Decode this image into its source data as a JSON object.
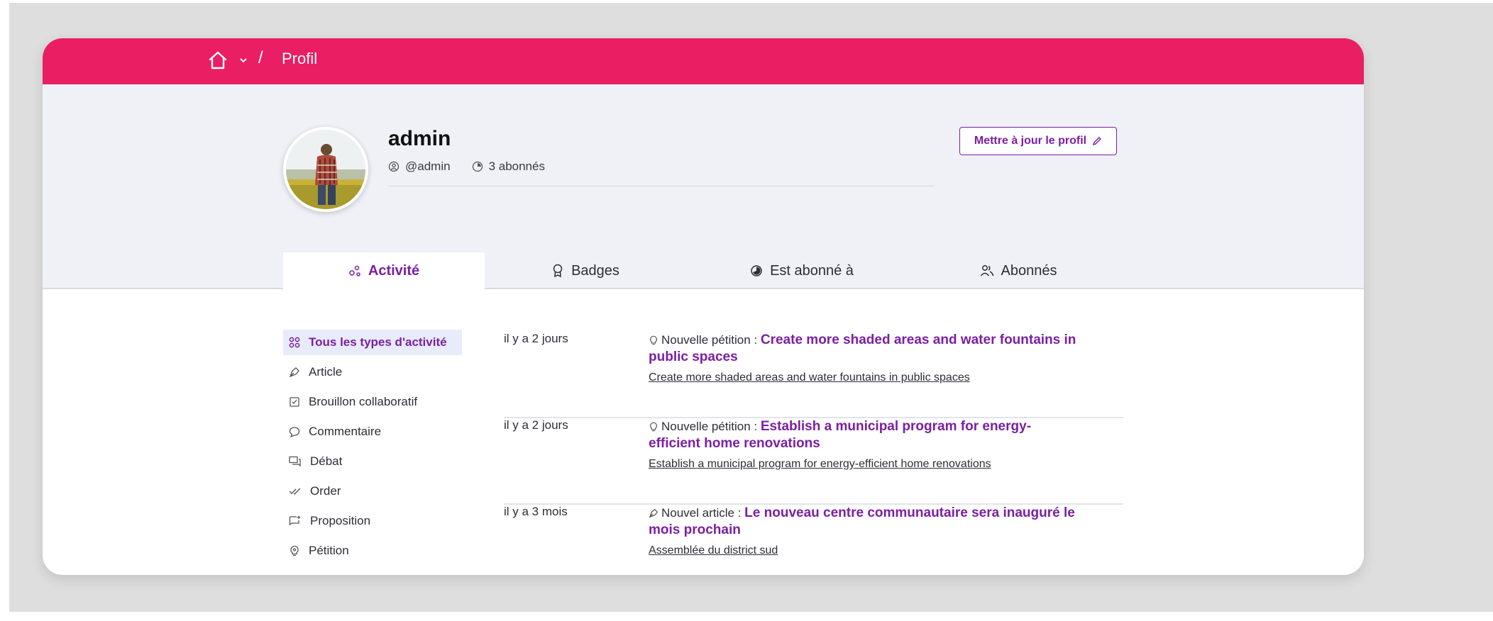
{
  "breadcrumb": {
    "separator": "/",
    "current": "Profil"
  },
  "icons": {
    "home": "home-icon",
    "chevron": "chevron-down-icon"
  },
  "profile": {
    "name": "admin",
    "nickname": "@admin",
    "followers": "3 abonnés",
    "update_button": "Mettre à jour le profil"
  },
  "tabs": [
    {
      "label": "Activité",
      "icon": "activity-icon"
    },
    {
      "label": "Badges",
      "icon": "badge-icon"
    },
    {
      "label": "Est abonné à",
      "icon": "follow-icon"
    },
    {
      "label": "Abonnés",
      "icon": "followers-icon"
    }
  ],
  "filters": [
    "Tous les types d'activité",
    "Article",
    "Brouillon collaboratif",
    "Commentaire",
    "Débat",
    "Order",
    "Proposition",
    "Pétition"
  ],
  "feed": [
    {
      "time": "il y a 2 jours",
      "prefix": "Nouvelle pétition : ",
      "title": "Create more shaded areas and water fountains in public spaces",
      "sub": "Create more shaded areas and water fountains in public spaces"
    },
    {
      "time": "il y a 2 jours",
      "prefix": "Nouvelle pétition : ",
      "title": "Establish a municipal program for energy-efficient home renovations",
      "sub": "Establish a municipal program for energy-efficient home renovations"
    },
    {
      "time": "il y a 3 mois",
      "prefix": "Nouvel article : ",
      "title": "Le nouveau centre communautaire sera inauguré le mois prochain",
      "sub": "Assemblée du district sud"
    }
  ],
  "colors": {
    "topbar": "#e91e63",
    "accent": "#7b1fa2",
    "band": "#f0f1f6"
  }
}
